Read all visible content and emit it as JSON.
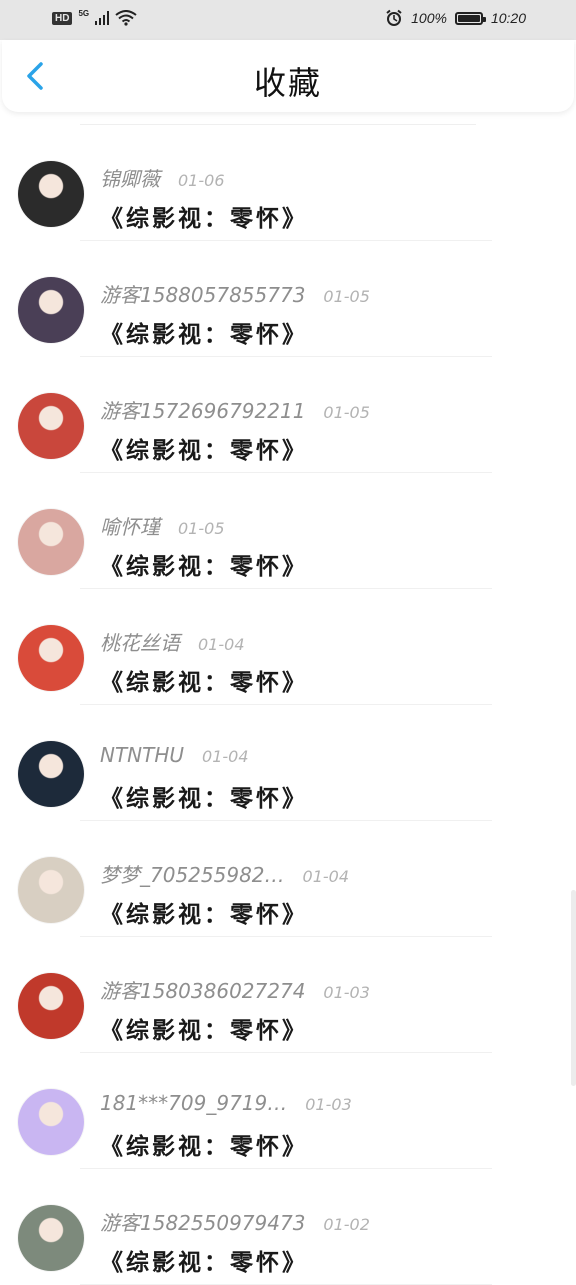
{
  "status_bar": {
    "hd": "HD",
    "network": "5G",
    "battery_text": "100%",
    "time": "10:20"
  },
  "header": {
    "title": "收藏",
    "back_icon": "chevron-left-icon",
    "accent": "#2aa3e8"
  },
  "favorites": [
    {
      "user": "锦卿薇",
      "date": "01-06",
      "work": "《综影视：零怀》",
      "avatar_color": "#2b2b2b"
    },
    {
      "user": "游客1588057855773",
      "date": "01-05",
      "work": "《综影视：零怀》",
      "avatar_color": "#4a3f56"
    },
    {
      "user": "游客1572696792211",
      "date": "01-05",
      "work": "《综影视：零怀》",
      "avatar_color": "#c9473c"
    },
    {
      "user": "喻怀瑾",
      "date": "01-05",
      "work": "《综影视：零怀》",
      "avatar_color": "#d9a7a0"
    },
    {
      "user": "桃花丝语",
      "date": "01-04",
      "work": "《综影视：零怀》",
      "avatar_color": "#d94b3a"
    },
    {
      "user": "NTNTHU",
      "date": "01-04",
      "work": "《综影视：零怀》",
      "avatar_color": "#1d2a3a"
    },
    {
      "user": "梦梦_705255982…",
      "date": "01-04",
      "work": "《综影视：零怀》",
      "avatar_color": "#d8cfc2"
    },
    {
      "user": "游客1580386027274",
      "date": "01-03",
      "work": "《综影视：零怀》",
      "avatar_color": "#c0392b"
    },
    {
      "user": "181***709_9719…",
      "date": "01-03",
      "work": "《综影视：零怀》",
      "avatar_color": "#c9b6f2"
    },
    {
      "user": "游客1582550979473",
      "date": "01-02",
      "work": "《综影视：零怀》",
      "avatar_color": "#7d8a7c"
    }
  ]
}
